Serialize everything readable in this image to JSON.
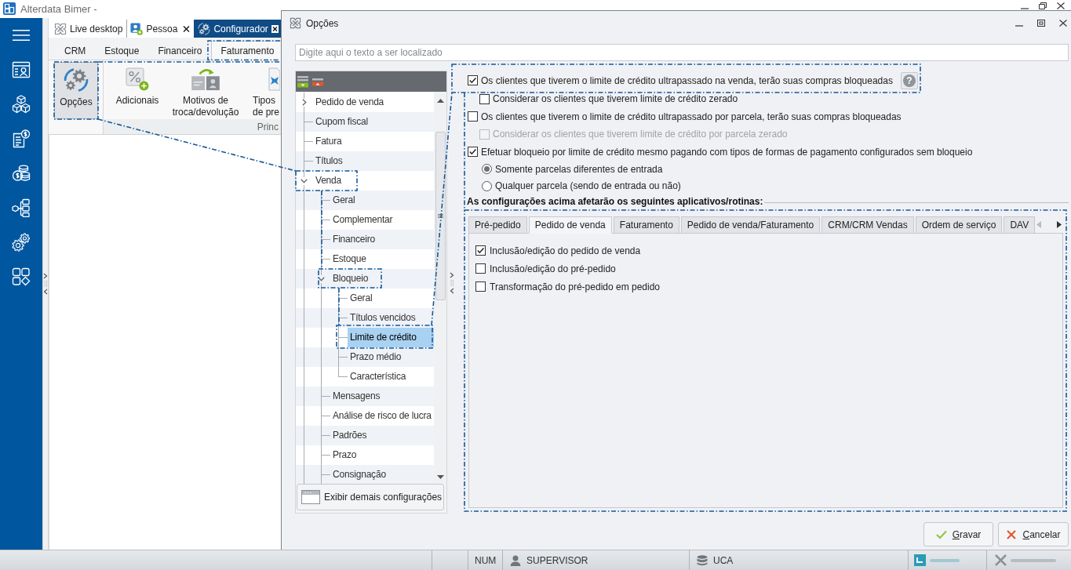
{
  "app_window": {
    "title": "Alterdata Bimer -"
  },
  "document_tabs": [
    {
      "label": "Live desktop",
      "kind": "desktop",
      "selected": false,
      "closable": false
    },
    {
      "label": "Pessoa",
      "kind": "person",
      "selected": false,
      "closable": true
    },
    {
      "label": "Configurador",
      "kind": "settings",
      "selected": true,
      "closable": true
    }
  ],
  "ribbon": {
    "tabs": [
      {
        "label": "CRM",
        "selected": false
      },
      {
        "label": "Estoque",
        "selected": false
      },
      {
        "label": "Financeiro",
        "selected": false
      },
      {
        "label": "Faturamento",
        "selected": true
      }
    ],
    "standalone_button": {
      "label": "Opções",
      "selected": true
    },
    "group": {
      "buttons": [
        {
          "label": "Adicionais",
          "kind": "percent",
          "selected": false
        },
        {
          "label": "Motivos de\ntroca/devolução",
          "kind": "swap",
          "selected": false
        },
        {
          "label": "Tipos\nde pre",
          "kind": "document",
          "selected": false
        }
      ],
      "label": "Princ"
    }
  },
  "options_dialog": {
    "title": "Opções",
    "search": {
      "placeholder": "Digite aqui o texto a ser localizado"
    },
    "tree": {
      "items": [
        {
          "label": "Pedido de venda",
          "expanded": false,
          "selected": false
        },
        {
          "label": "Cupom fiscal",
          "selected": false
        },
        {
          "label": "Fatura",
          "selected": false
        },
        {
          "label": "Títulos",
          "selected": false
        },
        {
          "label": "Venda",
          "expanded": true,
          "selected": false,
          "children": [
            {
              "label": "Geral",
              "selected": false
            },
            {
              "label": "Complementar",
              "selected": false
            },
            {
              "label": "Financeiro",
              "selected": false
            },
            {
              "label": "Estoque",
              "selected": false
            },
            {
              "label": "Bloqueio",
              "expanded": true,
              "selected": false,
              "children": [
                {
                  "label": "Geral",
                  "selected": false
                },
                {
                  "label": "Títulos vencidos",
                  "selected": false
                },
                {
                  "label": "Limite de crédito",
                  "selected": true
                },
                {
                  "label": "Prazo médio",
                  "selected": false
                },
                {
                  "label": "Característica",
                  "selected": false
                }
              ]
            },
            {
              "label": "Mensagens",
              "selected": false
            },
            {
              "label": "Análise de risco de lucra",
              "selected": false
            },
            {
              "label": "Padrões",
              "selected": false
            },
            {
              "label": "Prazo",
              "selected": false
            },
            {
              "label": "Consignação",
              "selected": false
            }
          ]
        }
      ]
    },
    "show_more_button": {
      "label": "Exibir demais configurações"
    },
    "options": [
      {
        "kind": "checkbox",
        "label": "Os clientes que tiverem o limite de crédito ultrapassado na venda, terão suas compras bloqueadas",
        "checked": true,
        "disabled": false,
        "help_button": {
          "label": "?"
        },
        "children": [
          {
            "kind": "checkbox",
            "label": "Considerar os clientes que tiverem limite de crédito zerado",
            "checked": false,
            "disabled": false
          }
        ]
      },
      {
        "kind": "checkbox",
        "label": "Os clientes que tiverem o limite de crédito ultrapassado por parcela, terão suas compras bloqueadas",
        "checked": false,
        "disabled": false,
        "children": [
          {
            "kind": "checkbox",
            "label": "Considerar os clientes que tiverem limite de crédito por parcela zerado",
            "checked": false,
            "disabled": true
          }
        ]
      },
      {
        "kind": "checkbox",
        "label": "Efetuar bloqueio por limite de crédito mesmo pagando com tipos de formas de pagamento configurados sem bloqueio",
        "checked": true,
        "disabled": false,
        "children": [
          {
            "kind": "radio",
            "label": "Somente parcelas diferentes de entrada",
            "selected": true
          },
          {
            "kind": "radio",
            "label": "Qualquer parcela (sendo de entrada ou não)",
            "selected": false
          }
        ]
      }
    ],
    "section_heading": "As configurações acima afetarão os seguintes aplicativos/rotinas:",
    "app_tabs": [
      {
        "label": "Pré-pedido",
        "selected": false
      },
      {
        "label": "Pedido de venda",
        "selected": true
      },
      {
        "label": "Faturamento",
        "selected": false
      },
      {
        "label": "Pedido de venda/Faturamento",
        "selected": false
      },
      {
        "label": "CRM/CRM Vendas",
        "selected": false
      },
      {
        "label": "Ordem de serviço",
        "selected": false
      },
      {
        "label": "DAV",
        "selected": false
      }
    ],
    "app_options": [
      {
        "label": "Inclusão/edição do pedido de venda",
        "checked": true
      },
      {
        "label": "Inclusão/edição do pré-pedido",
        "checked": false
      },
      {
        "label": "Transformação do pré-pedido em pedido",
        "checked": false
      }
    ],
    "buttons": [
      {
        "label": "Gravar",
        "kind": "confirm"
      },
      {
        "label": "Cancelar",
        "kind": "cancel"
      }
    ]
  },
  "status_bar": {
    "items": [
      {
        "kind": "text",
        "label": "NUM"
      },
      {
        "kind": "user",
        "label": "SUPERVISOR"
      },
      {
        "kind": "database",
        "label": "UCA"
      }
    ]
  }
}
